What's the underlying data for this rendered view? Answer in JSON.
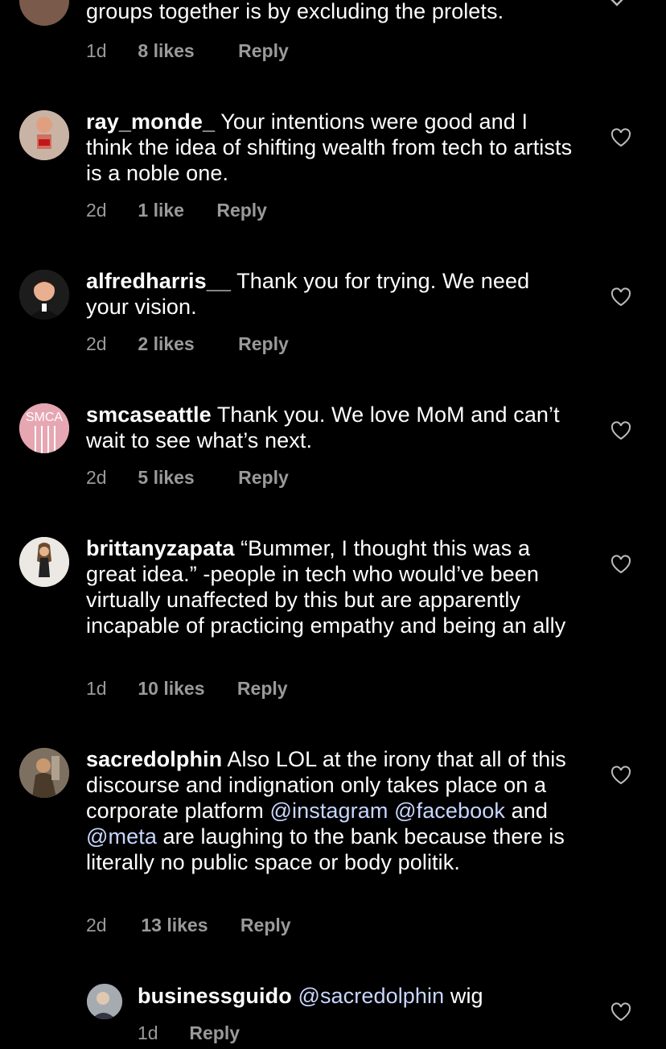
{
  "colors": {
    "background": "#000000",
    "text": "#ffffff",
    "muted": "#9a9a9a",
    "mention": "#c8d6ff"
  },
  "top_comment": {
    "text": "groups together is by excluding the prolets.",
    "time": "1d",
    "likes": "8 likes",
    "reply": "Reply"
  },
  "comments": [
    {
      "username": "ray_monde_",
      "text": "Your intentions were good and I think the idea of shifting wealth from tech to artists is a noble one.",
      "time": "2d",
      "likes": "1 like",
      "reply": "Reply"
    },
    {
      "username": "alfredharris__",
      "text": "Thank you for trying. We need your vision.",
      "time": "2d",
      "likes": "2 likes",
      "reply": "Reply"
    },
    {
      "username": "smcaseattle",
      "text": "Thank you. We love MoM and can’t wait to see what’s next.",
      "time": "2d",
      "likes": "5 likes",
      "reply": "Reply",
      "avatar_text": "SMCA"
    },
    {
      "username": "brittanyzapata",
      "text": "“Bummer, I thought this was a great idea.” -people in tech who would’ve been virtually unaffected by this but are apparently incapable of practicing empathy and being an ally",
      "time": "1d",
      "likes": "10 likes",
      "reply": "Reply"
    },
    {
      "username": "sacredolphin",
      "text_before": "Also LOL at the irony that all of this discourse and indignation only takes place on a corporate platform ",
      "mention1": "@instagram",
      "mention2": "@facebook",
      "text_mid": " and ",
      "mention3": "@meta",
      "text_after": " are laughing to the bank because there is literally no public space or body politik.",
      "time": "2d",
      "likes": "13 likes",
      "reply": "Reply"
    }
  ],
  "reply_comment": {
    "username": "businessguido",
    "mention": "@sacredolphin",
    "text": " wig",
    "time": "1d",
    "reply": "Reply"
  },
  "icons": {
    "like": "heart-outline-icon",
    "expand": "chevron-down-icon"
  }
}
